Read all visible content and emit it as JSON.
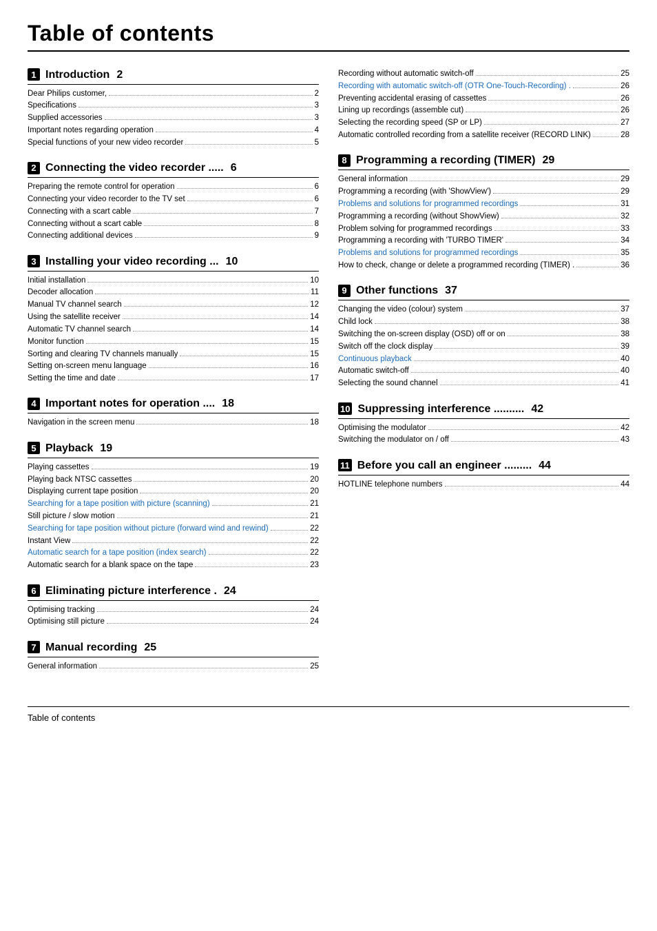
{
  "page": {
    "title": "Table of contents",
    "footer": "Table of contents"
  },
  "sections": {
    "left": [
      {
        "num": "1",
        "title": "Introduction",
        "dots": true,
        "page": "2",
        "entries": [
          {
            "text": "Dear Philips customer,",
            "page": "2",
            "blue": false
          },
          {
            "text": "Specifications",
            "page": "3",
            "blue": false
          },
          {
            "text": "Supplied accessories",
            "page": "3",
            "blue": false
          },
          {
            "text": "Important notes regarding operation",
            "page": "4",
            "blue": false
          },
          {
            "text": "Special functions of your new video recorder",
            "page": "5",
            "blue": false
          }
        ]
      },
      {
        "num": "2",
        "title": "Connecting the video recorder .....",
        "dots": false,
        "page": "6",
        "entries": [
          {
            "text": "Preparing the remote control for operation",
            "page": "6",
            "blue": false
          },
          {
            "text": "Connecting your video recorder to the TV set",
            "page": "6",
            "blue": false
          },
          {
            "text": "Connecting with a scart cable",
            "page": "7",
            "blue": false
          },
          {
            "text": "Connecting without a scart cable",
            "page": "8",
            "blue": false
          },
          {
            "text": "Connecting additional devices",
            "page": "9",
            "blue": false
          }
        ]
      },
      {
        "num": "3",
        "title": "Installing your video recording ...",
        "dots": false,
        "page": "10",
        "entries": [
          {
            "text": "Initial installation",
            "page": "10",
            "blue": false
          },
          {
            "text": "Decoder allocation",
            "page": "11",
            "blue": false
          },
          {
            "text": "Manual TV channel search",
            "page": "12",
            "blue": false
          },
          {
            "text": "Using the satellite receiver",
            "page": "14",
            "blue": false
          },
          {
            "text": "Automatic TV channel search",
            "page": "14",
            "blue": false
          },
          {
            "text": "Monitor function",
            "page": "15",
            "blue": false
          },
          {
            "text": "Sorting and clearing TV channels manually",
            "page": "15",
            "blue": false
          },
          {
            "text": "Setting on-screen menu language",
            "page": "16",
            "blue": false
          },
          {
            "text": "Setting the time and date",
            "page": "17",
            "blue": false
          }
        ]
      },
      {
        "num": "4",
        "title": "Important notes for operation ....",
        "dots": false,
        "page": "18",
        "entries": [
          {
            "text": "Navigation in the screen menu",
            "page": "18",
            "blue": false
          }
        ]
      },
      {
        "num": "5",
        "title": "Playback",
        "dots": true,
        "page": "19",
        "entries": [
          {
            "text": "Playing cassettes",
            "page": "19",
            "blue": false
          },
          {
            "text": "Playing back NTSC cassettes",
            "page": "20",
            "blue": false
          },
          {
            "text": "Displaying current tape position",
            "page": "20",
            "blue": false
          },
          {
            "text": "Searching for a tape position with picture (scanning)",
            "page": "21",
            "blue": true
          },
          {
            "text": "Still picture / slow motion",
            "page": "21",
            "blue": false
          },
          {
            "text": "Searching for tape position without picture (forward wind and rewind)",
            "page": "22",
            "blue": true
          },
          {
            "text": "Instant View",
            "page": "22",
            "blue": false
          },
          {
            "text": "Automatic search for a tape position (index search)",
            "page": "22",
            "blue": true
          },
          {
            "text": "Automatic search for a blank space on the tape",
            "page": "23",
            "blue": false
          }
        ]
      },
      {
        "num": "6",
        "title": "Eliminating picture interference .",
        "dots": false,
        "page": "24",
        "entries": [
          {
            "text": "Optimising tracking",
            "page": "24",
            "blue": false
          },
          {
            "text": "Optimising still picture",
            "page": "24",
            "blue": false
          }
        ]
      },
      {
        "num": "7",
        "title": "Manual recording",
        "dots": true,
        "page": "25",
        "entries": [
          {
            "text": "General information",
            "page": "25",
            "blue": false
          }
        ]
      }
    ],
    "right": [
      {
        "num": null,
        "title": null,
        "page": null,
        "entries": [
          {
            "text": "Recording without automatic switch-off",
            "page": "25",
            "blue": false
          },
          {
            "text": "Recording with automatic switch-off (OTR One-Touch-Recording) .",
            "page": "26",
            "blue": true
          },
          {
            "text": "Preventing accidental erasing of cassettes",
            "page": "26",
            "blue": false
          },
          {
            "text": "Lining up recordings (assemble cut)",
            "page": "26",
            "blue": false
          },
          {
            "text": "Selecting the recording speed (SP or LP)",
            "page": "27",
            "blue": false
          },
          {
            "text": "Automatic controlled recording from a satellite receiver (RECORD LINK)",
            "page": "28",
            "blue": false
          }
        ]
      },
      {
        "num": "8",
        "title": "Programming a recording (TIMER)",
        "dots": true,
        "page": "29",
        "entries": [
          {
            "text": "General information",
            "page": "29",
            "blue": false
          },
          {
            "text": "Programming a recording (with 'ShowView')",
            "page": "29",
            "blue": false
          },
          {
            "text": "Problems and solutions for programmed recordings",
            "page": "31",
            "blue": true
          },
          {
            "text": "Programming a recording (without ShowView)",
            "page": "32",
            "blue": false
          },
          {
            "text": "Problem solving for programmed recordings",
            "page": "33",
            "blue": false
          },
          {
            "text": "Programming a recording with 'TURBO TIMER'",
            "page": "34",
            "blue": false
          },
          {
            "text": "Problems and solutions for programmed recordings",
            "page": "35",
            "blue": true
          },
          {
            "text": "How to check, change or delete a programmed recording (TIMER) .",
            "page": "36",
            "blue": false
          }
        ]
      },
      {
        "num": "9",
        "title": "Other functions",
        "dots": true,
        "page": "37",
        "entries": [
          {
            "text": "Changing the video (colour) system",
            "page": "37",
            "blue": false
          },
          {
            "text": "Child lock",
            "page": "38",
            "blue": false
          },
          {
            "text": "Switching the on-screen display (OSD) off or on",
            "page": "38",
            "blue": false
          },
          {
            "text": "Switch off the clock display",
            "page": "39",
            "blue": false
          },
          {
            "text": "Continuous playback",
            "page": "40",
            "blue": true
          },
          {
            "text": "Automatic switch-off",
            "page": "40",
            "blue": false
          },
          {
            "text": "Selecting the sound channel",
            "page": "41",
            "blue": false
          }
        ]
      },
      {
        "num": "10",
        "title": "Suppressing interference ..........",
        "dots": false,
        "page": "42",
        "entries": [
          {
            "text": "Optimising the modulator",
            "page": "42",
            "blue": false
          },
          {
            "text": "Switching the modulator on / off",
            "page": "43",
            "blue": false
          }
        ]
      },
      {
        "num": "11",
        "title": "Before you call an engineer .........",
        "dots": false,
        "page": "44",
        "entries": [
          {
            "text": "HOTLINE telephone numbers",
            "page": "44",
            "blue": false
          }
        ]
      }
    ]
  }
}
